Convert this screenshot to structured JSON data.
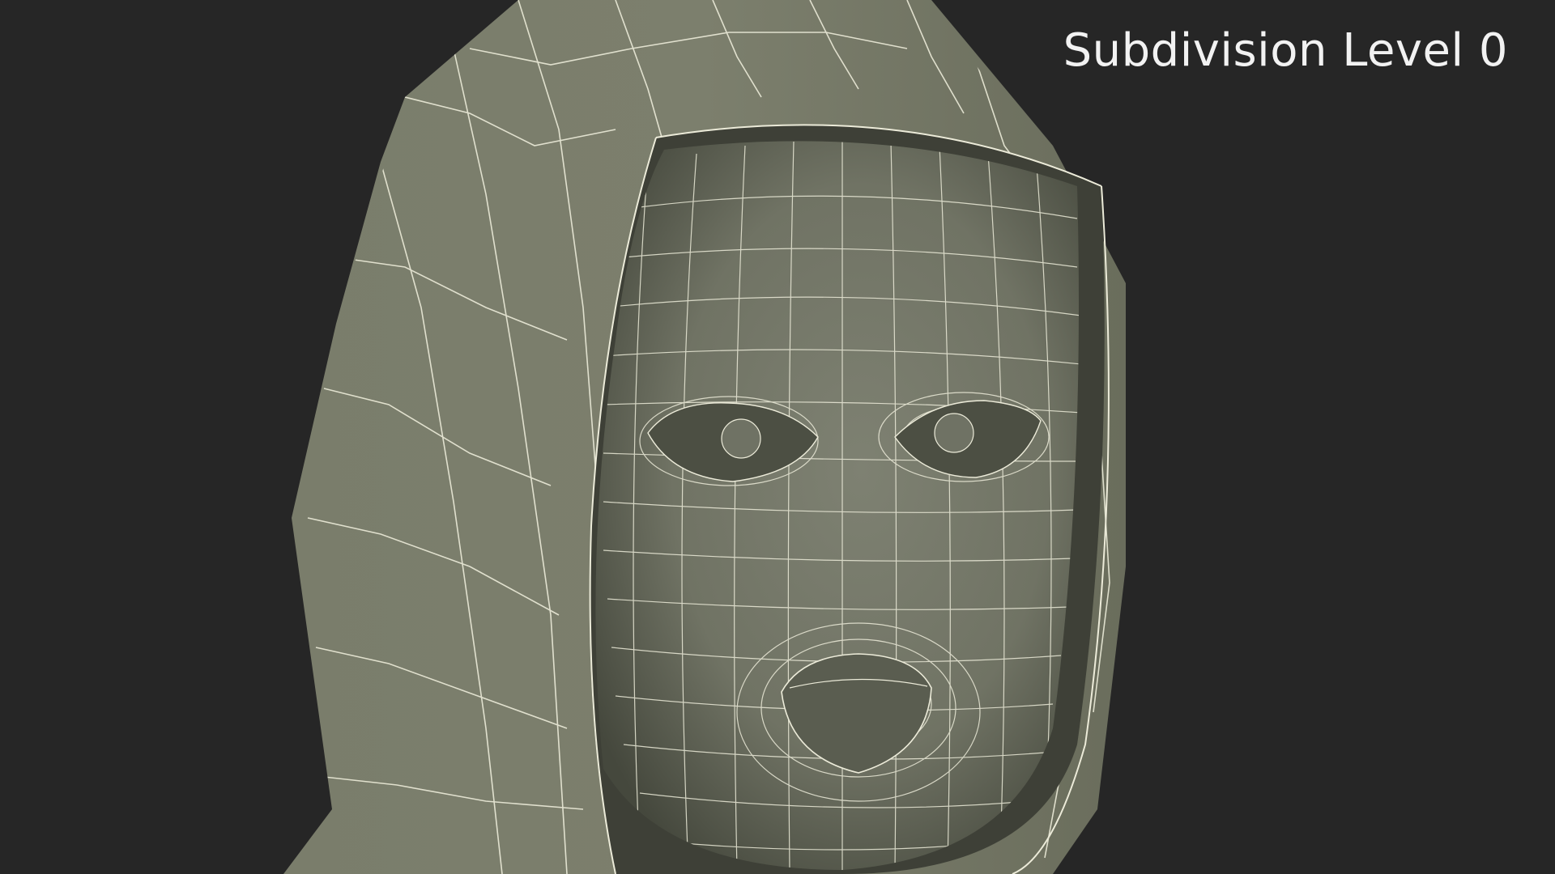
{
  "overlay": {
    "subdivision_label": "Subdivision Level 0"
  },
  "colors": {
    "background": "#262626",
    "hood_fill": "#7b7e6c",
    "face_fill": "#74776a",
    "face_shadow": "#4a4d42",
    "wireframe": "#eeeedd",
    "label": "#f2f2f2"
  },
  "scene": {
    "model_icon": "hooded-head-wireframe-icon"
  }
}
